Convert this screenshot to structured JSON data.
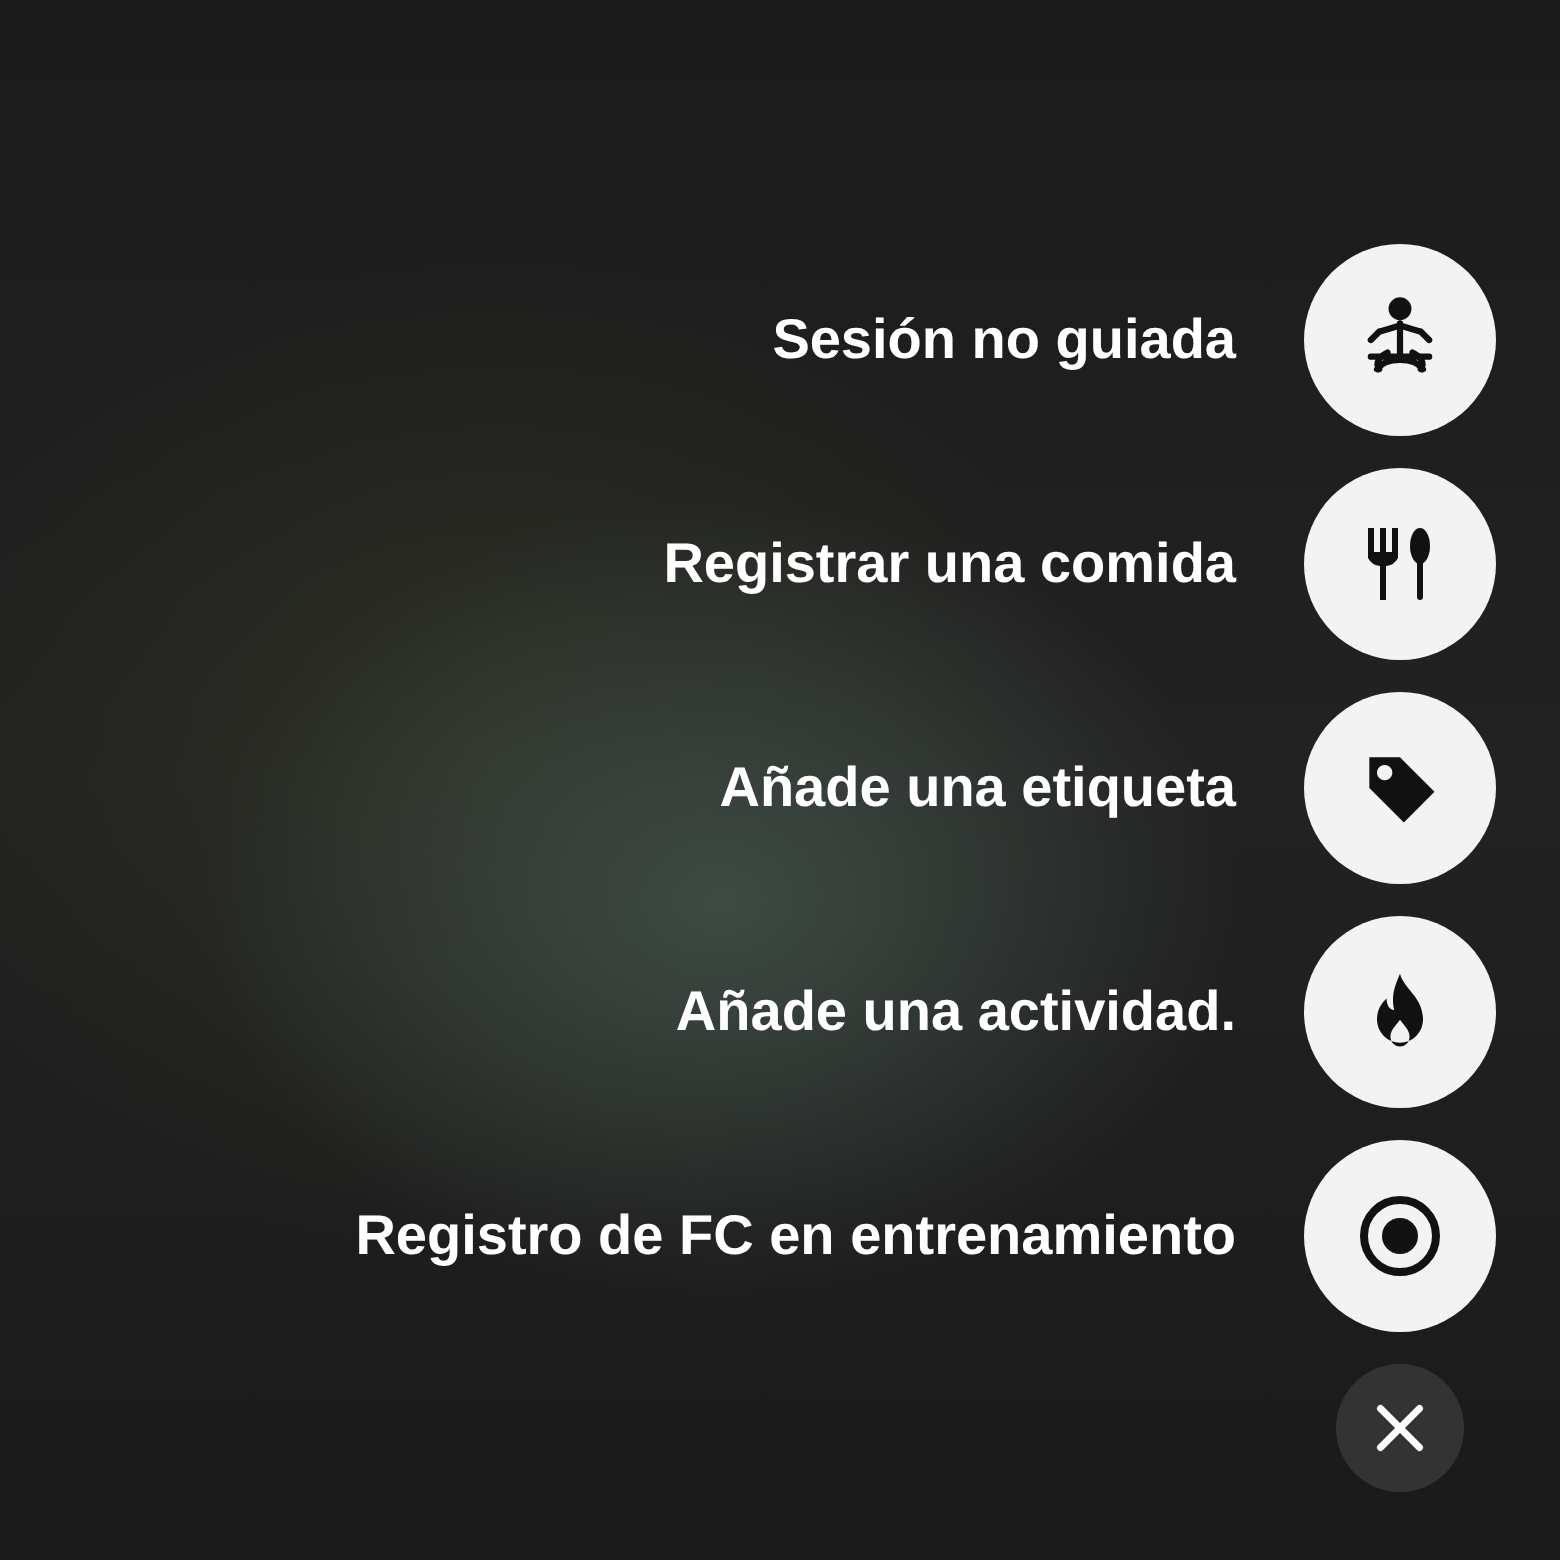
{
  "actions": [
    {
      "label": "Sesión no guiada",
      "kind": "meditation"
    },
    {
      "label": "Registrar una comida",
      "kind": "meal"
    },
    {
      "label": "Añade una etiqueta",
      "kind": "tag"
    },
    {
      "label": "Añade una actividad.",
      "kind": "flame"
    },
    {
      "label": "Registro de FC en entrenamiento",
      "kind": "target"
    }
  ]
}
